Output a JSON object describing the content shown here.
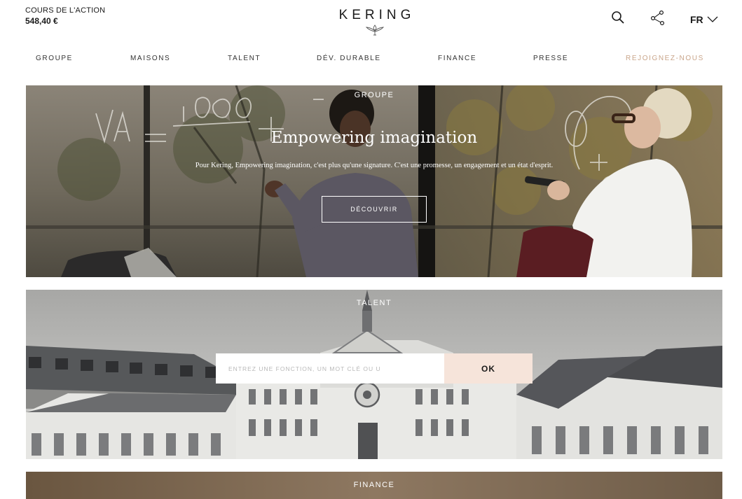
{
  "header": {
    "stock_label": "COURS DE L'ACTION",
    "stock_value": "548,40 €",
    "logo_text": "KERING",
    "search_icon": "search-icon",
    "share_icon": "share-icon",
    "language": "FR",
    "language_icon": "chevron-down-icon"
  },
  "nav": {
    "items": [
      {
        "label": "GROUPE"
      },
      {
        "label": "MAISONS"
      },
      {
        "label": "TALENT"
      },
      {
        "label": "DÉV. DURABLE"
      },
      {
        "label": "FINANCE"
      },
      {
        "label": "PRESSE"
      },
      {
        "label": "REJOIGNEZ-NOUS"
      }
    ],
    "accent_color": "#c9a58a"
  },
  "groupe": {
    "section_label": "GROUPE",
    "title": "Empowering imagination",
    "subtitle": "Pour Kering, Empowering imagination, c'est plus qu'une signature. C'est une promesse, un engagement et un état d'esprit.",
    "button_label": "DÉCOUVRIR"
  },
  "talent": {
    "section_label": "TALENT",
    "search_placeholder": "ENTREZ UNE FONCTION, UN MOT CLÉ OU U",
    "ok_label": "OK",
    "ok_color": "#f6e4da"
  },
  "finance": {
    "section_label": "FINANCE"
  }
}
